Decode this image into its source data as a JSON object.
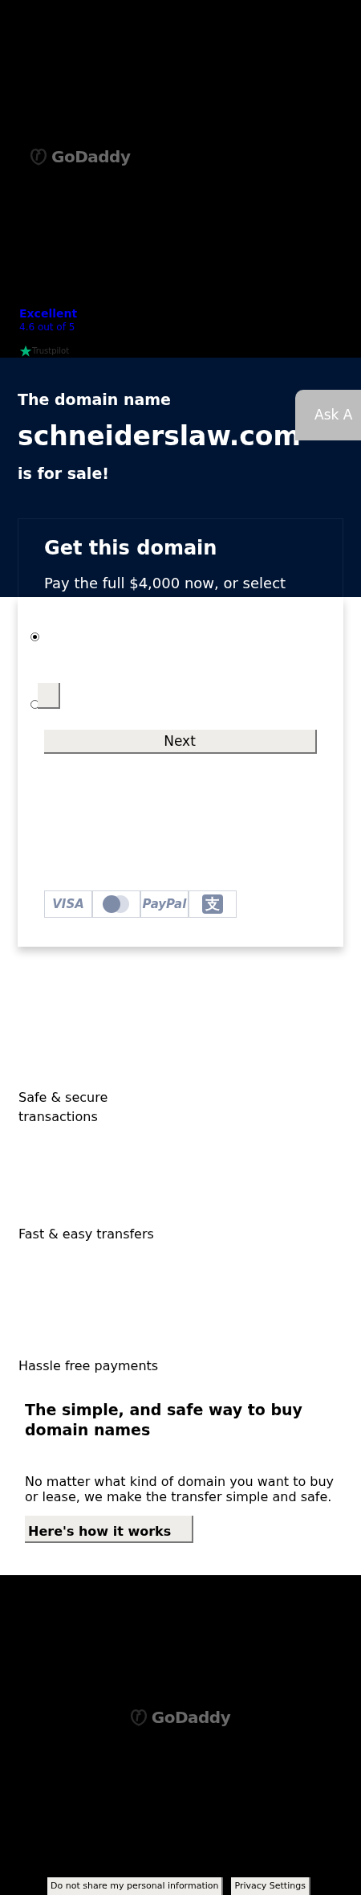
{
  "header": {
    "logo_text": "GoDaddy",
    "rating": {
      "label": "Excellent",
      "score": "4.6 out of 5",
      "brand": "Trustpilot"
    }
  },
  "hero": {
    "intro": "The domain name",
    "domain": "schneiderslaw.com",
    "outro": "is for sale!",
    "ask_button": "Ask A"
  },
  "purchase_card": {
    "title": "Get this domain",
    "description": "Pay the full $4,000 now, or select",
    "options": [
      {
        "selected": true
      },
      {
        "selected": false
      }
    ],
    "next_button": "Next",
    "payment_methods": [
      {
        "kind": "text",
        "label": "VISA"
      },
      {
        "kind": "circles"
      },
      {
        "kind": "text",
        "label": "PayPal"
      },
      {
        "kind": "glyph",
        "label": "支"
      }
    ]
  },
  "features": [
    {
      "label": "Safe & secure transactions"
    },
    {
      "label": "Fast & easy transfers"
    },
    {
      "label": "Hassle free payments"
    }
  ],
  "info": {
    "title": "The simple, and safe way to buy domain names",
    "body": "No matter what kind of domain you want to buy or lease, we make the transfer simple and safe.",
    "button": "Here's how it works"
  },
  "footer": {
    "logo_text": "GoDaddy",
    "buttons": [
      "Do not share my personal information",
      "Privacy Settings"
    ]
  }
}
